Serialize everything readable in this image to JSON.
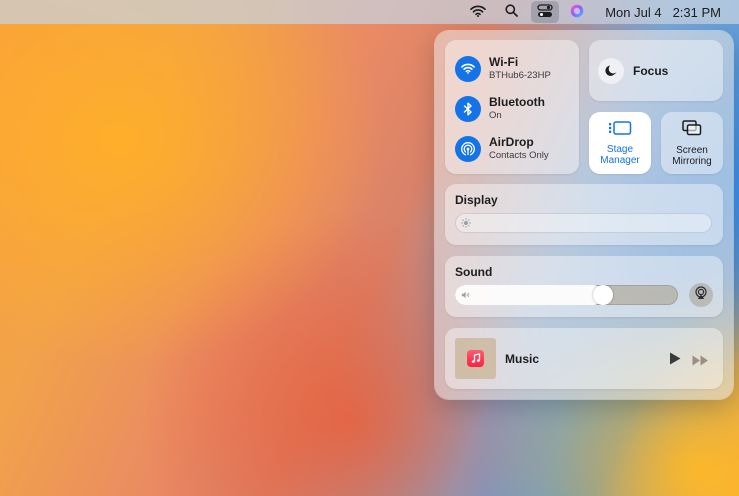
{
  "menubar": {
    "wifi_icon": "wifi-icon",
    "search_icon": "search-icon",
    "control_center_icon": "control-center-icon",
    "siri_icon": "siri-icon",
    "date": "Mon Jul 4",
    "time": "2:31 PM"
  },
  "control_center": {
    "network": {
      "items": [
        {
          "title": "Wi-Fi",
          "subtitle": "BTHub6-23HP",
          "icon": "wifi-icon"
        },
        {
          "title": "Bluetooth",
          "subtitle": "On",
          "icon": "bluetooth-icon"
        },
        {
          "title": "AirDrop",
          "subtitle": "Contacts Only",
          "icon": "airdrop-icon"
        }
      ]
    },
    "focus": {
      "label": "Focus",
      "icon": "moon-icon"
    },
    "stage_manager": {
      "label": "Stage\nManager",
      "icon": "stage-manager-icon",
      "active": true
    },
    "screen_mirroring": {
      "label": "Screen\nMirroring",
      "icon": "screen-mirroring-icon"
    },
    "display": {
      "title": "Display",
      "brightness": 0.0,
      "icon": "sun-icon"
    },
    "sound": {
      "title": "Sound",
      "volume": 0.68,
      "icon": "speaker-icon",
      "airplay_icon": "airplay-audio-icon"
    },
    "now_playing": {
      "app": "Music",
      "icon": "music-app-icon"
    }
  },
  "colors": {
    "accent": "#1473e6",
    "music_red": "#fa233b"
  }
}
